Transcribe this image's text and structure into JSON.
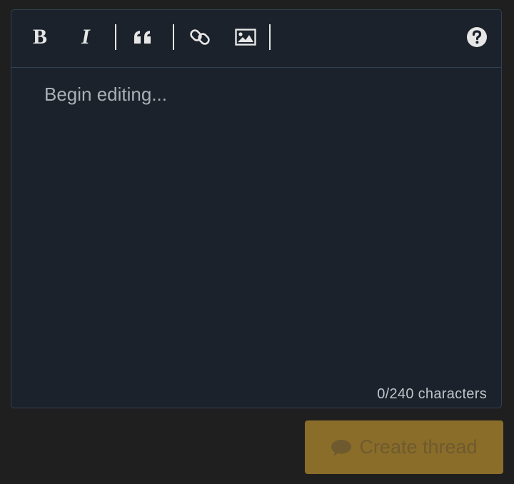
{
  "toolbar": {
    "bold_label": "B",
    "italic_label": "I",
    "quote_icon": "quote-icon",
    "link_icon": "link-icon",
    "image_icon": "image-icon",
    "help_icon": "question-circle-icon"
  },
  "editor": {
    "placeholder": "Begin editing...",
    "value": "",
    "char_count": "0/240 characters"
  },
  "submit": {
    "label": "Create thread",
    "icon": "comment-icon",
    "disabled": true
  },
  "colors": {
    "background": "#1f1f1f",
    "editor_bg": "#1b222b",
    "border": "#2f4152",
    "button_bg": "#8b6d2a",
    "button_text": "#6e5a2e"
  }
}
